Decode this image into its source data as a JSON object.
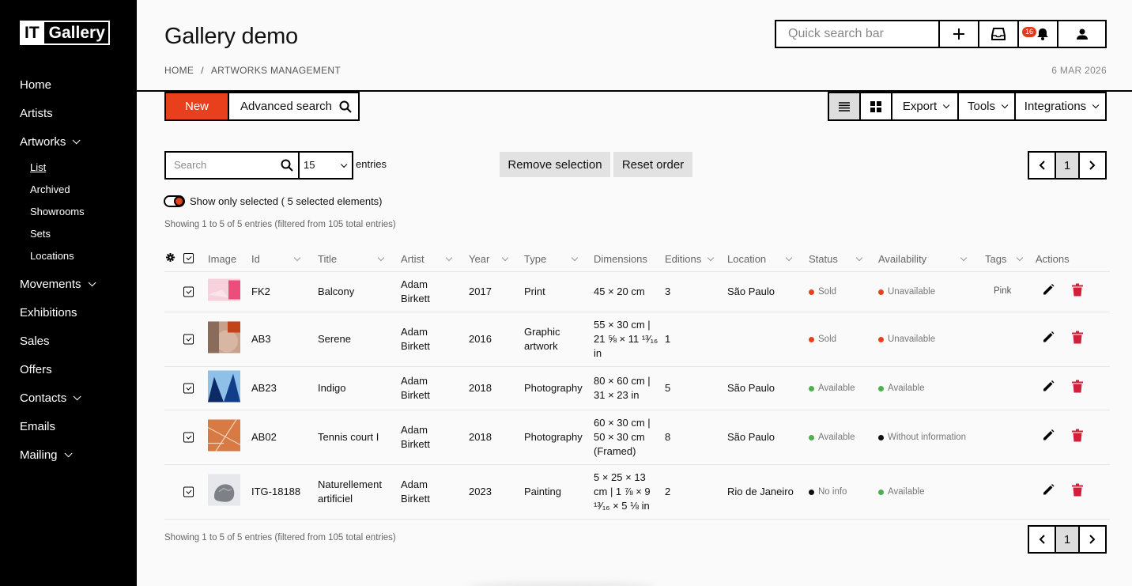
{
  "sidebar": {
    "logo_a": "IT",
    "logo_b": "Gallery",
    "items": {
      "home": "Home",
      "artists": "Artists",
      "artworks": "Artworks",
      "movements": "Movements",
      "exhibitions": "Exhibitions",
      "sales": "Sales",
      "offers": "Offers",
      "contacts": "Contacts",
      "emails": "Emails",
      "mailing": "Mailing"
    },
    "artworks_sub": {
      "list": "List",
      "archived": "Archived",
      "showrooms": "Showrooms",
      "sets": "Sets",
      "locations": "Locations"
    }
  },
  "header": {
    "title": "Gallery demo",
    "breadcrumb_home": "HOME",
    "breadcrumb_sep": "/",
    "breadcrumb_current": "ARTWORKS MANAGEMENT",
    "date": "6 MAR 2026",
    "quick_search_placeholder": "Quick search bar",
    "notification_count": "16"
  },
  "toolbar": {
    "new_label": "New",
    "advanced_search_label": "Advanced search",
    "export_label": "Export",
    "tools_label": "Tools",
    "integrations_label": "Integrations"
  },
  "filters": {
    "search_placeholder": "Search",
    "per_page": "15",
    "entries_label": "entries",
    "remove_selection": "Remove selection",
    "reset_order": "Reset order",
    "page": "1",
    "toggle_label": "Show only selected ( 5 selected elements)",
    "showing_text": "Showing 1 to 5 of 5 entries (filtered from 105 total entries)"
  },
  "table": {
    "headers": {
      "image": "Image",
      "id": "Id",
      "title": "Title",
      "artist": "Artist",
      "year": "Year",
      "type": "Type",
      "dimensions": "Dimensions",
      "editions": "Editions",
      "location": "Location",
      "status": "Status",
      "availability": "Availability",
      "tags": "Tags",
      "actions": "Actions"
    },
    "rows": [
      {
        "id": "FK2",
        "title": "Balcony",
        "artist_1": "Adam",
        "artist_2": "Birkett",
        "year": "2017",
        "type": "Print",
        "dim_1": "45 × 20 cm",
        "dim_2": "",
        "dim_3": "",
        "editions": "3",
        "location": "São Paulo",
        "status": "Sold",
        "status_color": "#e8401c",
        "availability": "Unavailable",
        "availability_color": "#e8401c",
        "tag": "Pink"
      },
      {
        "id": "AB3",
        "title": "Serene",
        "artist_1": "Adam",
        "artist_2": "Birkett",
        "year": "2016",
        "type": "Graphic artwork",
        "dim_1": "55 × 30 cm |",
        "dim_2": "21 ⅝ × 11 ¹³⁄₁₆",
        "dim_3": "in",
        "editions": "1",
        "location": "",
        "status": "Sold",
        "status_color": "#e8401c",
        "availability": "Unavailable",
        "availability_color": "#e8401c",
        "tag": ""
      },
      {
        "id": "AB23",
        "title": "Indigo",
        "artist_1": "Adam",
        "artist_2": "Birkett",
        "year": "2018",
        "type": "Photography",
        "dim_1": "80 × 60 cm |",
        "dim_2": "31 × 23 in",
        "dim_3": "",
        "editions": "5",
        "location": "São Paulo",
        "status": "Available",
        "status_color": "#4caf50",
        "availability": "Available",
        "availability_color": "#4caf50",
        "tag": ""
      },
      {
        "id": "AB02",
        "title": "Tennis court I",
        "artist_1": "Adam",
        "artist_2": "Birkett",
        "year": "2018",
        "type": "Photography",
        "dim_1": "60 × 30 cm |",
        "dim_2": "50 × 30 cm",
        "dim_3": "(Framed)",
        "editions": "8",
        "location": "São Paulo",
        "status": "Available",
        "status_color": "#4caf50",
        "availability": "Without information",
        "availability_color": "#111111",
        "tag": ""
      },
      {
        "id": "ITG-18188",
        "title": "Naturellement artificiel",
        "artist_1": "Adam",
        "artist_2": "Birkett",
        "year": "2023",
        "type": "Painting",
        "dim_1": "5 × 25 × 13",
        "dim_2": "cm | 1 ⅞ × 9",
        "dim_3": "¹³⁄₁₆ × 5 ⅛ in",
        "editions": "2",
        "location": "Rio de Janeiro",
        "status": "No info",
        "status_color": "#111111",
        "availability": "Available",
        "availability_color": "#4caf50",
        "tag": ""
      }
    ]
  },
  "colors": {
    "accent": "#e8401c",
    "delete": "#d3203a",
    "available": "#4caf50"
  }
}
